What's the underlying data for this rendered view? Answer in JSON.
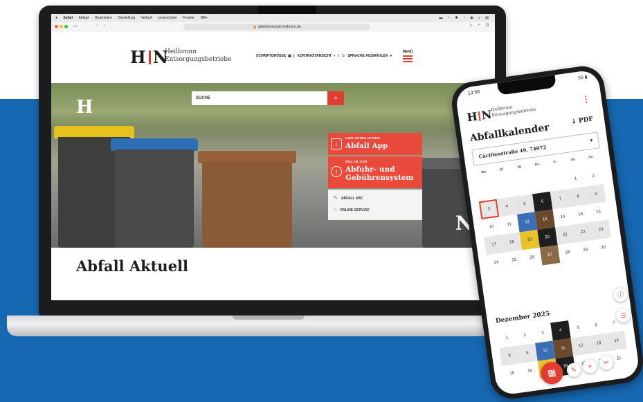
{
  "laptop": {
    "macbar": {
      "app": "Safari",
      "menu": [
        "Ablage",
        "Bearbeiten",
        "Darstellung",
        "Verlauf",
        "Lesezeichen",
        "Fenster",
        "Hilfe"
      ]
    },
    "safari": {
      "url": "abfallwirtschaft.heilbronn.de"
    },
    "site": {
      "logo_mark_left": "H",
      "logo_mark_right": "N",
      "logo_line1": "Heilbronn",
      "logo_line2": "Entsorgungsbetriebe",
      "util_font": "SCHRIFTGRÖSSE",
      "util_contrast": "KONTRASTANSICHT",
      "util_language": "SPRACHE AUSWÄHLEN",
      "menu_label": "MENÜ",
      "search_label": "SUCHE",
      "hero_letter_left": "H",
      "hero_letter_right": "N",
      "promo_app_small": "HIER DOWNLOADEN",
      "promo_app_big": "Abfall App",
      "promo_system_small": "NEU AB 2026",
      "promo_system_big_1": "Abfuhr- und",
      "promo_system_big_2": "Gebührensystem",
      "link_abc": "ABFALL ABC",
      "link_online": "ONLINE-SERVICE",
      "section_title": "Abfall Aktuell"
    }
  },
  "phone": {
    "time": "13:58",
    "network": "5G",
    "logo_mark_left": "H",
    "logo_mark_right": "N",
    "logo_line1": "Heilbronn",
    "logo_line2": "Entsorgungsbetriebe",
    "title": "Abfallkalender",
    "pdf_label": "PDF",
    "address": "Cäcilienstraße 49, 74072",
    "weekdays": [
      "Mo",
      "Di",
      "Mi",
      "Do",
      "Fr",
      "Sa",
      "So"
    ],
    "november": [
      {
        "day": "",
        "color": ""
      },
      {
        "day": "",
        "color": ""
      },
      {
        "day": "",
        "color": ""
      },
      {
        "day": "",
        "color": ""
      },
      {
        "day": "",
        "color": ""
      },
      {
        "day": "1",
        "color": ""
      },
      {
        "day": "2",
        "color": ""
      },
      {
        "day": "3",
        "color": "today"
      },
      {
        "day": "4",
        "color": ""
      },
      {
        "day": "5",
        "color": ""
      },
      {
        "day": "6",
        "color": "#1e1e1e"
      },
      {
        "day": "7",
        "color": ""
      },
      {
        "day": "8",
        "color": ""
      },
      {
        "day": "9",
        "color": ""
      },
      {
        "day": "10",
        "color": ""
      },
      {
        "day": "11",
        "color": ""
      },
      {
        "day": "12",
        "color": "#3a6fb6"
      },
      {
        "day": "13",
        "color": "#6b4a2b"
      },
      {
        "day": "14",
        "color": ""
      },
      {
        "day": "15",
        "color": ""
      },
      {
        "day": "16",
        "color": ""
      },
      {
        "day": "17",
        "color": ""
      },
      {
        "day": "18",
        "color": ""
      },
      {
        "day": "19",
        "color": "#e8c22a"
      },
      {
        "day": "20",
        "color": "#1e1e1e"
      },
      {
        "day": "21",
        "color": ""
      },
      {
        "day": "22",
        "color": ""
      },
      {
        "day": "23",
        "color": ""
      },
      {
        "day": "24",
        "color": ""
      },
      {
        "day": "25",
        "color": ""
      },
      {
        "day": "26",
        "color": ""
      },
      {
        "day": "27",
        "color": "#8b6a45"
      },
      {
        "day": "28",
        "color": ""
      },
      {
        "day": "29",
        "color": ""
      },
      {
        "day": "30",
        "color": ""
      }
    ],
    "december_title": "Dezember 2025",
    "december": [
      {
        "day": "1",
        "color": ""
      },
      {
        "day": "2",
        "color": ""
      },
      {
        "day": "3",
        "color": ""
      },
      {
        "day": "4",
        "color": "#1e1e1e"
      },
      {
        "day": "5",
        "color": ""
      },
      {
        "day": "6",
        "color": ""
      },
      {
        "day": "7",
        "color": ""
      },
      {
        "day": "8",
        "color": ""
      },
      {
        "day": "9",
        "color": ""
      },
      {
        "day": "10",
        "color": "#3a6fb6"
      },
      {
        "day": "11",
        "color": "#6b4a2b"
      },
      {
        "day": "12",
        "color": ""
      },
      {
        "day": "13",
        "color": ""
      },
      {
        "day": "14",
        "color": ""
      },
      {
        "day": "15",
        "color": ""
      },
      {
        "day": "16",
        "color": ""
      },
      {
        "day": "17",
        "color": "#e8c22a"
      },
      {
        "day": "18",
        "color": "#1e1e1e"
      },
      {
        "day": "19",
        "color": ""
      },
      {
        "day": "20",
        "color": ""
      },
      {
        "day": "21",
        "color": ""
      }
    ]
  },
  "colors": {
    "brand_red": "#e23b2f",
    "background_blue": "#1668b2"
  }
}
